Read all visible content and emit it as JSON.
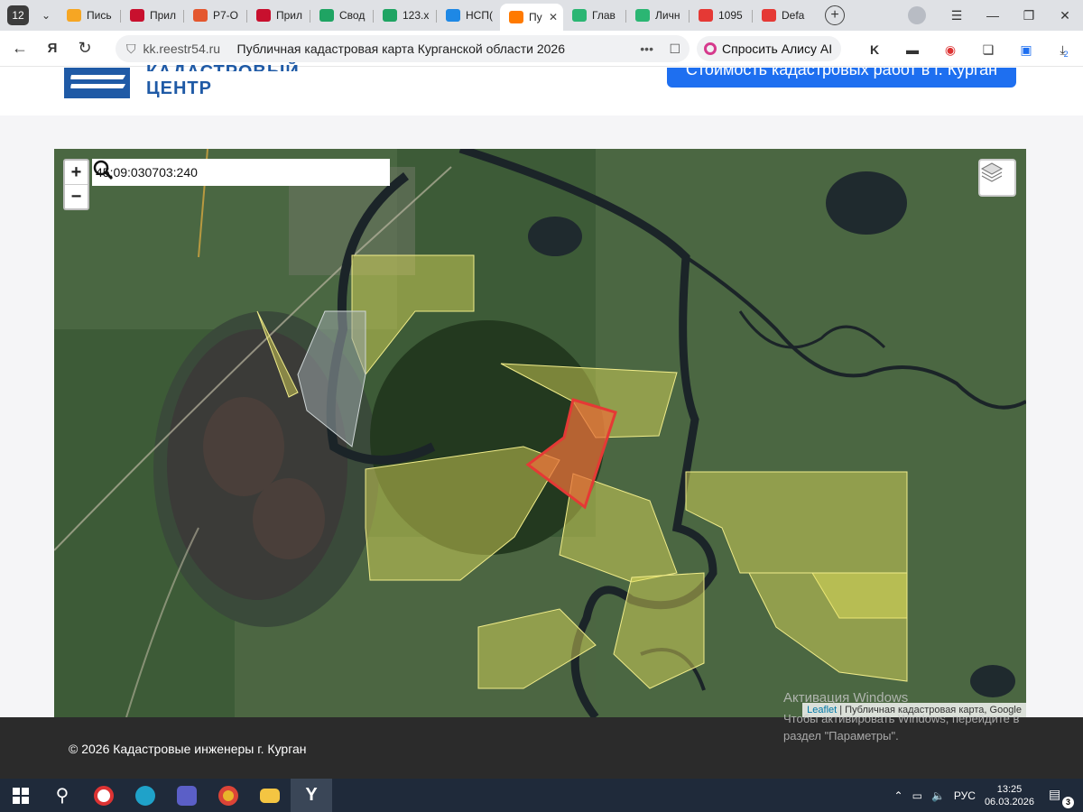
{
  "browser": {
    "tab_count": "12",
    "tabs": [
      {
        "label": "Пись",
        "color": "#f6a623"
      },
      {
        "label": "Прил",
        "color": "#c8102e"
      },
      {
        "label": "Р7-О",
        "color": "#e4572e"
      },
      {
        "label": "Прил",
        "color": "#c8102e"
      },
      {
        "label": "Свод",
        "color": "#1fa463"
      },
      {
        "label": "123.x",
        "color": "#1fa463"
      },
      {
        "label": "НСП(",
        "color": "#1e88e5"
      },
      {
        "label": "Пу",
        "color": "#ff7a00"
      },
      {
        "label": "Глав",
        "color": "#2bb673"
      },
      {
        "label": "Личн",
        "color": "#2bb673"
      },
      {
        "label": "1095",
        "color": "#e53935"
      },
      {
        "label": "Defa",
        "color": "#e53935"
      }
    ],
    "url_domain": "kk.reestr54.ru",
    "page_title": "Публичная кадастровая карта Курганской области 2026",
    "alice_label": "Спросить Алису AI",
    "ext_badge": "2"
  },
  "site": {
    "logo_top": "КАДАСТРОВЫЙ",
    "logo_bottom": "ЦЕНТР",
    "cta_label": "Стоимость кадастровых работ в г. Курган",
    "brand_color": "#1f5aa6",
    "cta_color": "#1e6ff0"
  },
  "map": {
    "search_value": "45:09:030703:240",
    "zoom_in": "+",
    "zoom_out": "−",
    "attribution_leaflet": "Leaflet",
    "attribution_rest": " | Публичная кадастровая карта, Google",
    "selected_parcel_color": "#e53935",
    "parcel_color": "#e6e35a"
  },
  "footer": {
    "copyright": "© 2026 Кадастровые инженеры г. Курган"
  },
  "windows": {
    "watermark_title": "Активация Windows",
    "watermark_text": "Чтобы активировать Windows, перейдите в раздел \"Параметры\"."
  },
  "taskbar": {
    "lang": "РУС",
    "time": "13:25",
    "date": "06.03.2026",
    "notifications": "3"
  }
}
